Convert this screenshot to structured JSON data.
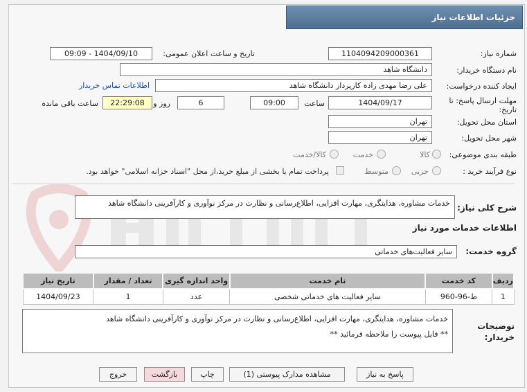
{
  "header": {
    "title": "جزئیات اطلاعات نیاز"
  },
  "fields": {
    "need_number_label": "شماره نیاز:",
    "need_number": "1104094209000361",
    "announce_label": "تاریخ و ساعت اعلان عمومی:",
    "announce_value": "1404/09/10 - 09:09",
    "buyer_org_label": "نام دستگاه خریدار:",
    "buyer_org": "دانشگاه شاهد",
    "creator_label": "ایجاد کننده درخواست:",
    "creator": "علی رضا مهدی زاده کارپرداز دانشگاه شاهد",
    "contact_link": "اطلاعات تماس خریدار",
    "deadline_label_1": "مهلت ارسال پاسخ: تا",
    "deadline_label_2": "تاریخ:",
    "deadline_date": "1404/09/17",
    "time_label": "ساعت",
    "deadline_time": "09:00",
    "days_value": "6",
    "days_label": "روز و",
    "remaining_time": "22:29:08",
    "remaining_label": "ساعت باقی مانده",
    "province_label": "استان محل تحویل:",
    "province": "تهران",
    "city_label": "شهر محل تحویل:",
    "city": "تهران",
    "category_label": "طبقه بندی موضوعی:",
    "category_options": [
      "کالا",
      "خدمت",
      "کالا/خدمت"
    ],
    "process_label": "نوع فرآیند خرید :",
    "process_options": [
      "جزیی",
      "متوسط"
    ],
    "payment_note": "پرداخت تمام یا بخشی از مبلغ خرید،از محل \"اسناد خزانه اسلامی\" خواهد بود."
  },
  "summary": {
    "label": "شرح کلی نیاز:",
    "text": "خدمات مشاوره، هدایتگری، مهارت افزایی، اطلاع‌رسانی و نظارت در مرکز نوآوری و کارآفرینی دانشگاه شاهد"
  },
  "services": {
    "section_title": "اطلاعات خدمات مورد نیاز",
    "group_label": "گروه خدمت:",
    "group_value": "سایر فعالیت‌های خدماتی",
    "columns": [
      "ردیف",
      "کد خدمت",
      "نام خدمت",
      "واحد اندازه گیری",
      "تعداد / مقدار",
      "تاریخ نیاز"
    ],
    "rows": [
      [
        "1",
        "ط-96-960",
        "سایر فعالیت های خدماتی شخصی",
        "عدد",
        "1",
        "1404/09/23"
      ]
    ]
  },
  "notes": {
    "label_1": "توضیحات",
    "label_2": "خریدار:",
    "line_1": "خدمات مشاوره، هدایتگری، مهارت افزایی، اطلاع‌رسانی و نظارت در مرکز نوآوری و کارآفرینی دانشگاه شاهد",
    "line_2": "** فایل پیوست را ملاحظه فرمائید **"
  },
  "buttons": {
    "reply": "پاسخ به نیاز",
    "attachments": "مشاهده مدارک پیوستی (1)",
    "print": "چاپ",
    "back": "بازگشت",
    "exit": "خروج"
  },
  "colors": {
    "header": "#4e6f91",
    "link": "#1a4fb0",
    "remaining_bg": "#ffffc8",
    "table_header": "#bcbcbc",
    "back_button": "#f6d9dc"
  }
}
